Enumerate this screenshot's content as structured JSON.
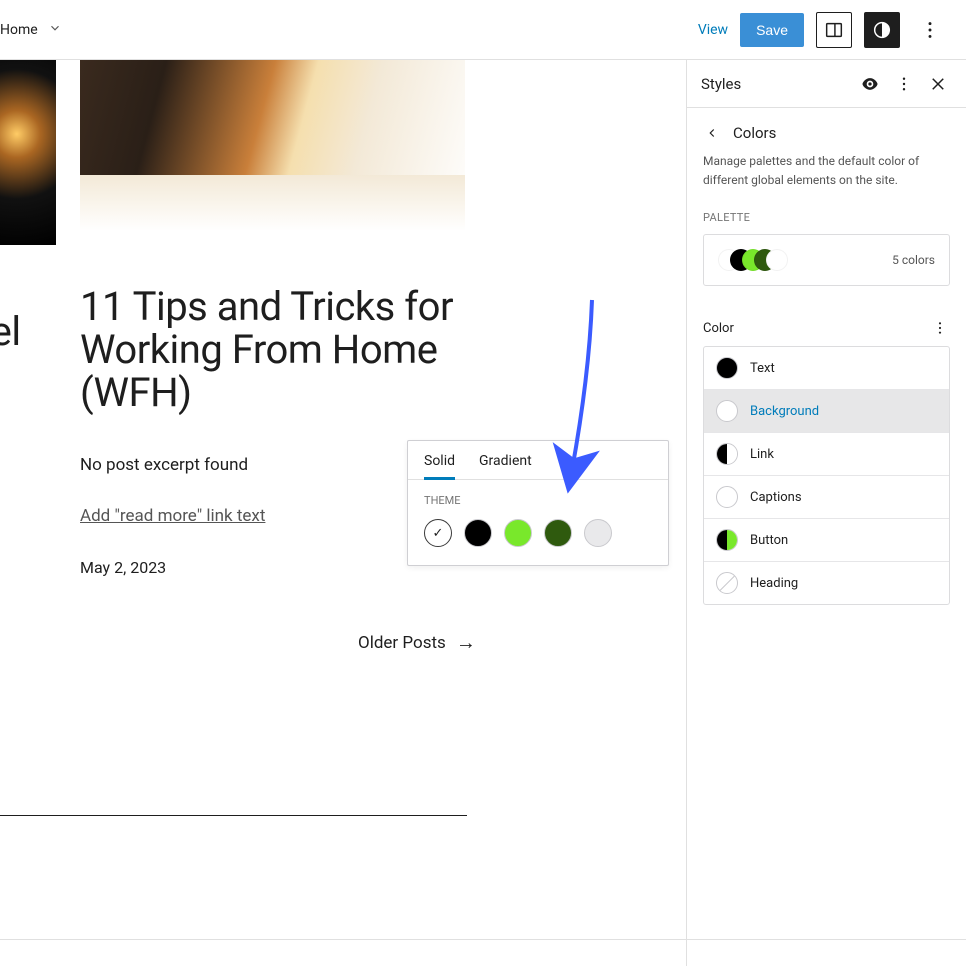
{
  "topbar": {
    "home": "Home",
    "view": "View",
    "save": "Save"
  },
  "sidebar": {
    "title": "Styles",
    "colors": {
      "title": "Colors",
      "description": "Manage palettes and the default color of different global elements on the site.",
      "palette_label": "PALETTE",
      "palette_count": "5 colors",
      "palette_swatches": [
        "#ffffff",
        "#000000",
        "#79e82b",
        "#2f5a0e"
      ],
      "color_label": "Color",
      "items": [
        {
          "label": "Text",
          "swatch": {
            "type": "solid",
            "color": "#000000"
          },
          "active": false
        },
        {
          "label": "Background",
          "swatch": {
            "type": "outline"
          },
          "active": true
        },
        {
          "label": "Link",
          "swatch": {
            "type": "split",
            "left": "#000000",
            "right": "#ffffff"
          },
          "active": false
        },
        {
          "label": "Captions",
          "swatch": {
            "type": "outline"
          },
          "active": false
        },
        {
          "label": "Button",
          "swatch": {
            "type": "split",
            "left": "#000000",
            "right": "#79e82b"
          },
          "active": false
        },
        {
          "label": "Heading",
          "swatch": {
            "type": "diag"
          },
          "active": false
        }
      ]
    }
  },
  "canvas": {
    "left_label": "vel",
    "post_title": "11 Tips and Tricks for Working From Home (WFH)",
    "excerpt": "No post excerpt found",
    "read_more": "Add \"read more\" link text",
    "date": "May 2, 2023",
    "older_posts": "Older Posts"
  },
  "popover": {
    "tabs": {
      "solid": "Solid",
      "gradient": "Gradient"
    },
    "theme_label": "THEME",
    "swatches": [
      {
        "color": "#ffffff",
        "selected": true
      },
      {
        "color": "#000000",
        "selected": false
      },
      {
        "color": "#79e82b",
        "selected": false
      },
      {
        "color": "#2f5a0e",
        "selected": false
      },
      {
        "color": "#e9e9eb",
        "selected": false
      }
    ]
  }
}
